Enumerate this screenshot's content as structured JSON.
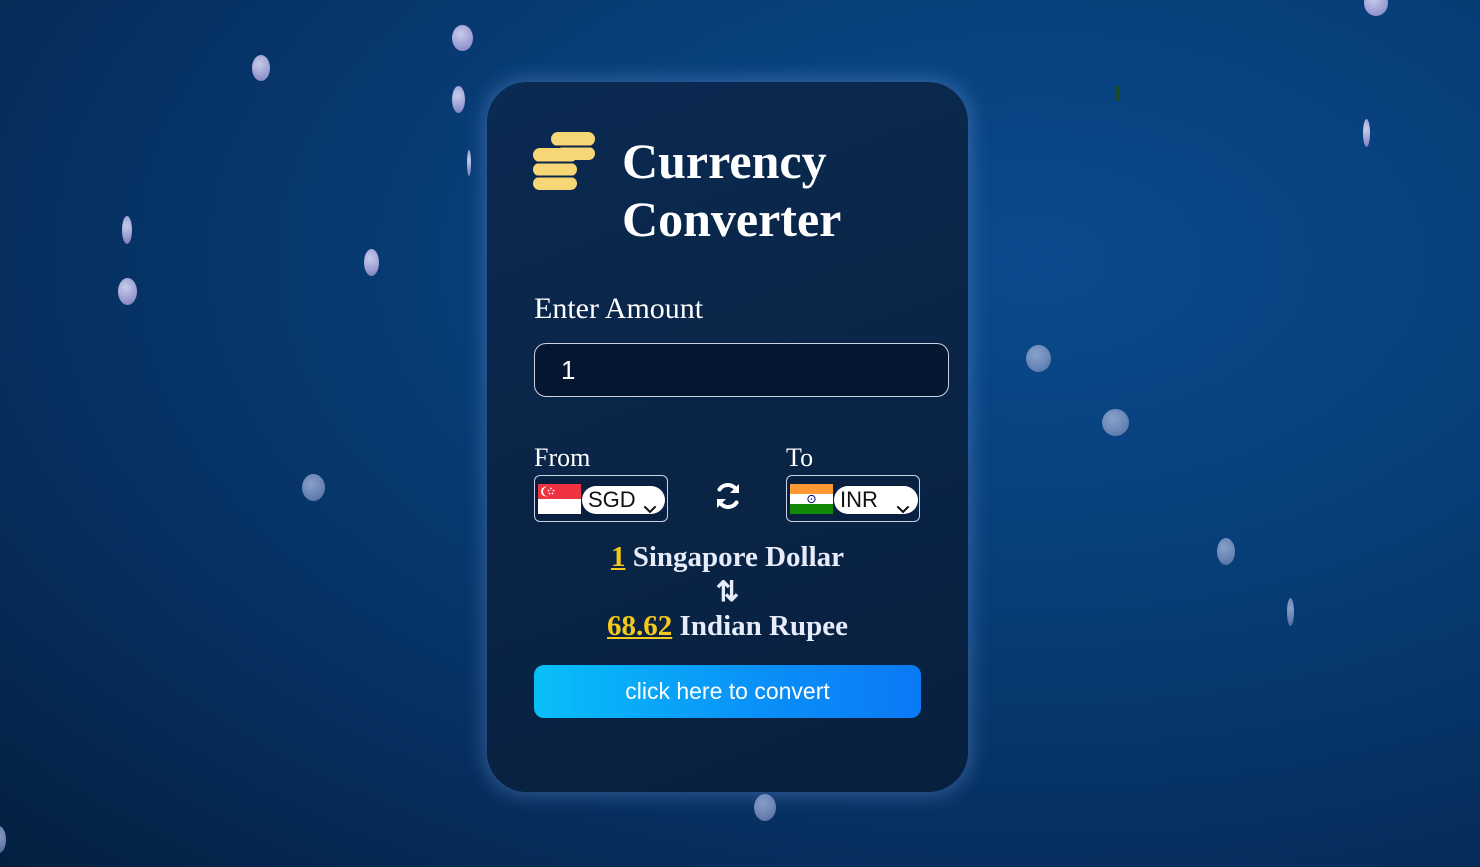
{
  "app": {
    "title": "Currency Converter"
  },
  "amount": {
    "label": "Enter Amount",
    "value": "1"
  },
  "from": {
    "label": "From",
    "currency": "SGD",
    "flag": "singapore-flag"
  },
  "to": {
    "label": "To",
    "currency": "INR",
    "flag": "india-flag"
  },
  "result": {
    "from_amount": "1",
    "from_name": "Singapore Dollar",
    "arrows": "⇅",
    "to_amount": "68.62",
    "to_name": "Indian Rupee"
  },
  "convert_button": {
    "label": "click here to convert"
  },
  "colors": {
    "accent": "#f4c91b",
    "button_start": "#08bff8",
    "button_end": "#0b79f5",
    "background": "#083f7a",
    "card": "#0a2547"
  },
  "icons": {
    "title": "coins-icon",
    "swap": "swap-icon",
    "dropdown": "chevron-down-icon"
  }
}
